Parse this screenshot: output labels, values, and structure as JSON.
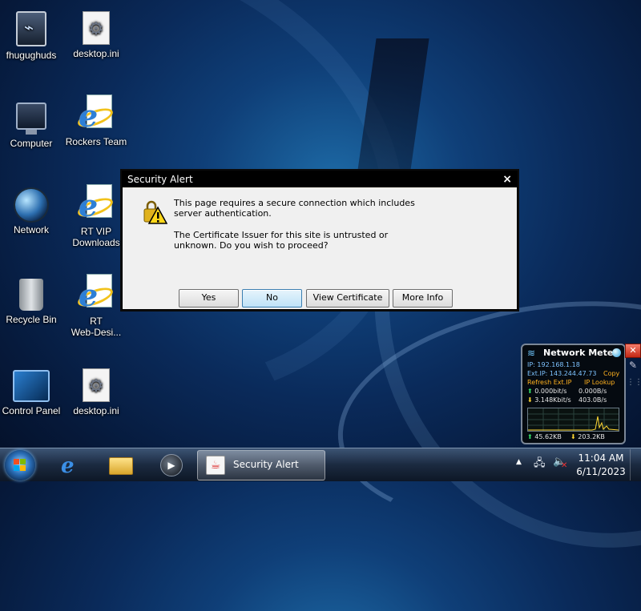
{
  "desktop": {
    "icons": [
      {
        "label": "fhugughuds",
        "icon": "user-icon"
      },
      {
        "label": "desktop.ini",
        "icon": "config-file-icon"
      },
      {
        "label": "Computer",
        "icon": "computer-icon"
      },
      {
        "label": "Rockers Team",
        "icon": "internet-explorer-icon"
      },
      {
        "label": "Network",
        "icon": "network-icon"
      },
      {
        "label": "RT VIP\nDownloads",
        "icon": "internet-explorer-icon"
      },
      {
        "label": "Recycle Bin",
        "icon": "recycle-bin-icon"
      },
      {
        "label": "RT\nWeb-Desi...",
        "icon": "internet-explorer-icon"
      },
      {
        "label": "Control Panel",
        "icon": "control-panel-icon"
      },
      {
        "label": "desktop.ini",
        "icon": "config-file-icon"
      }
    ]
  },
  "dialog": {
    "title": "Security Alert",
    "close_label": "×",
    "icon": "warning-lock-icon",
    "message_1": "This page requires a secure connection which includes\nserver authentication.",
    "message_2": "The Certificate Issuer for this site is untrusted or\nunknown.  Do you wish to proceed?",
    "buttons": {
      "yes": "Yes",
      "no": "No",
      "view_certificate": "View Certificate",
      "more_info": "More Info"
    },
    "focused_button": "No"
  },
  "gadget": {
    "title": "Network Meter",
    "ip": "IP: 192.168.1.18",
    "ext_ip": "Ext.IP: 143.244.47.73",
    "copy": "Copy",
    "refresh": "Refresh Ext.IP",
    "lookup": "IP Lookup",
    "up_rate_bits": "0.000bit/s",
    "up_rate_bytes": "0.000B/s",
    "down_rate_bits": "3.148Kbit/s",
    "down_rate_bytes": "403.0B/s",
    "total_up": "45.62KB",
    "total_down": "203.2KB",
    "close_label": "✕",
    "colors": {
      "accent": "#7ec3ff",
      "up": "#35e06a",
      "down": "#ffd633",
      "link": "#ffb11f"
    }
  },
  "taskbar": {
    "pinned": [
      "internet-explorer-icon",
      "folder-icon",
      "media-player-icon"
    ],
    "active_window": "Security Alert",
    "clock_time": "11:04 AM",
    "clock_date": "6/11/2023"
  }
}
